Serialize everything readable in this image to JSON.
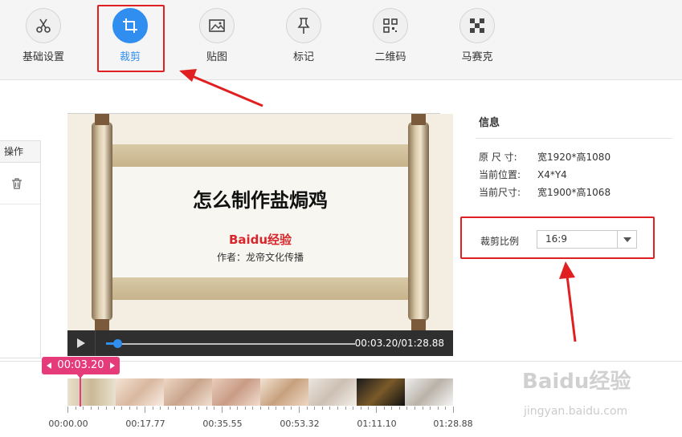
{
  "toolbar": {
    "tools": [
      {
        "label": "基础设置",
        "icon": "scissors-icon"
      },
      {
        "label": "裁剪",
        "icon": "crop-icon",
        "active": true
      },
      {
        "label": "贴图",
        "icon": "image-icon"
      },
      {
        "label": "标记",
        "icon": "pin-icon"
      },
      {
        "label": "二维码",
        "icon": "qr-code-icon"
      },
      {
        "label": "马赛克",
        "icon": "mosaic-icon"
      }
    ]
  },
  "left_panel": {
    "header": "操作"
  },
  "preview": {
    "title": "怎么制作盐焗鸡",
    "logo_text": "Baidu经验",
    "author": "作者：龙帝文化传播"
  },
  "player": {
    "time": "00:03.20/01:28.88",
    "progress": 0.036
  },
  "info": {
    "title": "信息",
    "rows": [
      {
        "key": "原 尺 寸:",
        "value": "宽1920*高1080"
      },
      {
        "key": "当前位置:",
        "value": "X4*Y4"
      },
      {
        "key": "当前尺寸:",
        "value": "宽1900*高1068"
      }
    ],
    "crop_ratio_label": "裁剪比例",
    "crop_ratio_value": "16:9"
  },
  "timeline": {
    "cursor_time": "00:03.20",
    "labels": [
      "00:00.00",
      "00:17.77",
      "00:35.55",
      "00:53.32",
      "01:11.10",
      "01:28.88"
    ]
  },
  "watermark": {
    "text": "Baidu经验",
    "url": "jingyan.baidu.com"
  },
  "colors": {
    "accent": "#2f8ef0",
    "highlight": "#e02020",
    "cursor": "#e63b7a"
  }
}
